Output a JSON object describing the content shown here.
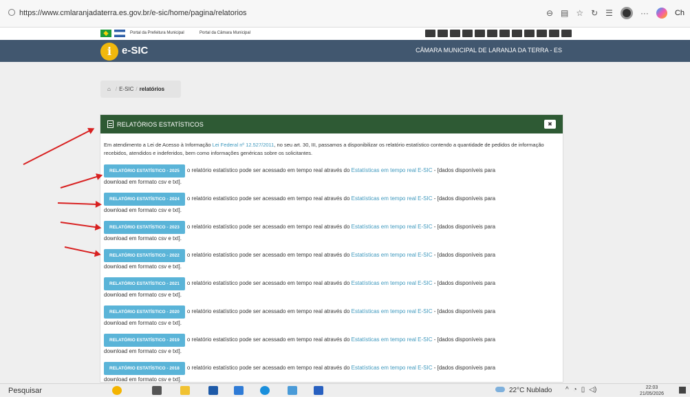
{
  "browser": {
    "url": "https://www.cmlaranjadaterra.es.gov.br/e-sic/home/pagina/relatorios",
    "profile_label": "Ch"
  },
  "gov_bar": {
    "link1": "Portal da Prefeitura Municipal",
    "link2": "Portal da Câmara Municipal"
  },
  "header": {
    "logo_letter": "i",
    "logo_text": "e-SIC",
    "org_name": "CÂMARA MUNICIPAL DE LARANJA DA TERRA - ES"
  },
  "breadcrumb": {
    "home_icon": "home-icon",
    "item1": "E-SIC",
    "current": "relatórios"
  },
  "panel": {
    "title": "RELATÓRIOS ESTATÍSTICOS",
    "intro_before": "Em atendimento a Lei de Acesso à Informação ",
    "intro_link": "Lei Federal nº 12.527/2011",
    "intro_after": ", no seu art. 30, III, passamos a disponibilizar os relatório estatístico contendo a quantidade de pedidos de informação recebidos, atendidos e indeferidos, bem como informações genéricas sobre os solicitantes.",
    "row_text_before": "o relatório estatístico pode ser acessado em tempo real através do ",
    "row_link": "Estatísticas em tempo real E-SIC",
    "row_text_after": " - [dados disponíveis para",
    "row_continuation": "download em formato csv e txt].",
    "reports": [
      {
        "label": "RELATÓRIO ESTATÍSTICO - 2025"
      },
      {
        "label": "RELATÓRIO ESTATÍSTICO - 2024"
      },
      {
        "label": "RELATÓRIO ESTATÍSTICO - 2023"
      },
      {
        "label": "RELATÓRIO ESTATÍSTICO - 2022"
      },
      {
        "label": "RELATÓRIO ESTATÍSTICO - 2021"
      },
      {
        "label": "RELATÓRIO ESTATÍSTICO - 2020"
      },
      {
        "label": "RELATÓRIO ESTATÍSTICO - 2019"
      },
      {
        "label": "RELATÓRIO ESTATÍSTICO - 2018"
      }
    ]
  },
  "taskbar": {
    "search": "Pesquisar",
    "weather": "22°C  Nublado",
    "time": "22:03",
    "date": "21/05/2026"
  },
  "colors": {
    "header_bg": "#41576f",
    "panel_head": "#2e5a34",
    "report_button": "#5ab4d8",
    "link": "#3e98bd",
    "arrow": "#d82020"
  }
}
